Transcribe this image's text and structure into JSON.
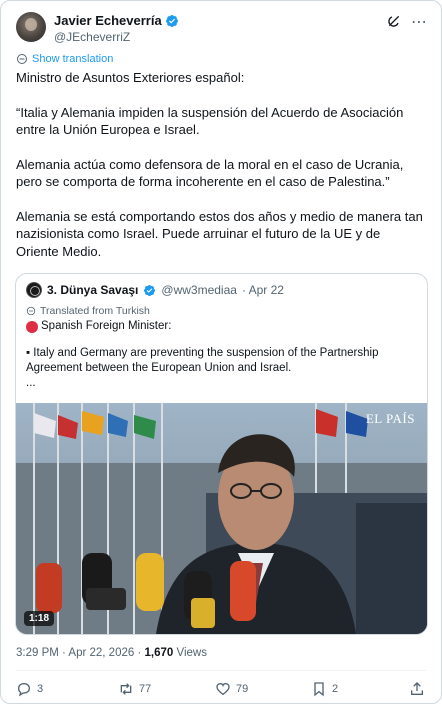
{
  "author": {
    "name": "Javier Echeverría",
    "handle": "@JEcheverriZ"
  },
  "translation_link": "Show translation",
  "body": {
    "p1": "Ministro de Asuntos Exteriores español:",
    "p2": "“Italia y Alemania impiden la suspensión del Acuerdo de Asociación entre la Unión Europea e Israel.",
    "p3": "Alemania actúa como defensora de la moral en el caso de Ucrania, pero se comporta de forma incoherente en el caso de Palestina.”",
    "p4": "Alemania se está comportando estos dos años y medio de manera tan nazisionista como Israel. Puede arruinar el futuro de la UE y de Oriente Medio."
  },
  "quote": {
    "name": "3. Dünya Savaşı",
    "handle": "@ww3mediaa",
    "date": "· Apr 22",
    "translated_label": "Translated from Turkish",
    "line1": "Spanish Foreign Minister:",
    "bullet": "▪ Italy and Germany are preventing the suspension of the Partnership Agreement between the European Union and Israel.",
    "ellipsis": "...",
    "media_watermark": "EL PAÍS",
    "duration": "1:18"
  },
  "meta": {
    "time_date": "3:29 PM · Apr 22, 2026 · ",
    "views_count": "1,670",
    "views_label": " Views"
  },
  "actions": {
    "replies": "3",
    "reposts": "77",
    "likes": "79",
    "bookmarks": "2"
  },
  "colors": {
    "accent": "#1d9bf0",
    "text": "#0f1419",
    "muted": "#536471",
    "border": "#cfd9de"
  }
}
